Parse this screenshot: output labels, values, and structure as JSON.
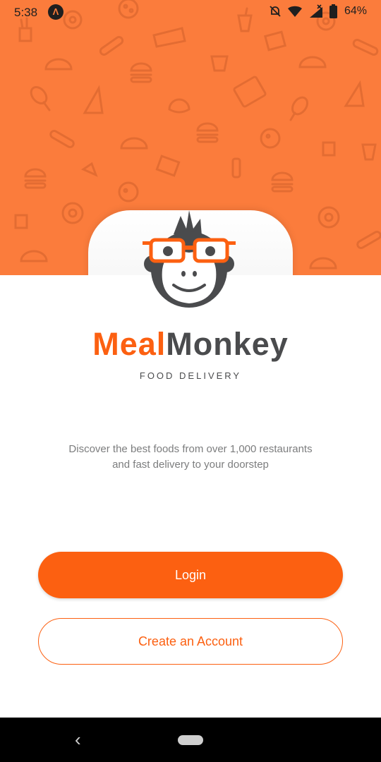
{
  "status_bar": {
    "time": "5:38",
    "app_icon_glyph": "Λ",
    "icons": [
      "notifications-off-icon",
      "wifi-icon",
      "signal-icon",
      "battery-icon"
    ],
    "battery_text": "64%"
  },
  "brand": {
    "name_part1": "Meal",
    "name_part2": "Monkey",
    "tagline": "FOOD DELIVERY"
  },
  "description": "Discover the best foods from over 1,000 restaurants and fast delivery to your doorstep",
  "buttons": {
    "login": "Login",
    "create_account": "Create an Account"
  },
  "nav_bar": {
    "back_glyph": "‹"
  },
  "colors": {
    "accent": "#fc6011",
    "hero_background": "#fb7c3c",
    "text_dark": "#4a4b4d",
    "text_secondary": "#7c7d7e"
  }
}
